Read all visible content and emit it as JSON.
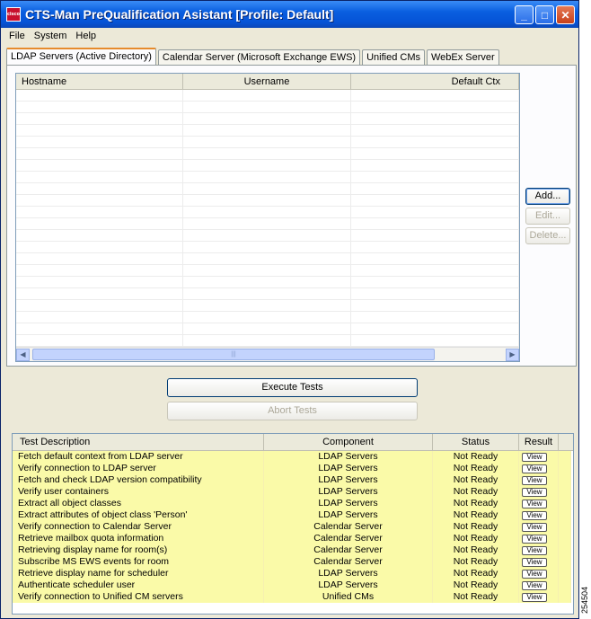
{
  "window": {
    "title": "CTS-Man PreQualification Asistant [Profile: Default]",
    "icon_text": "cisco"
  },
  "menu": [
    "File",
    "System",
    "Help"
  ],
  "tabs": [
    {
      "label": "LDAP Servers (Active Directory)",
      "active": true
    },
    {
      "label": "Calendar Server (Microsoft Exchange EWS)",
      "active": false
    },
    {
      "label": "Unified CMs",
      "active": false
    },
    {
      "label": "WebEx Server",
      "active": false
    }
  ],
  "server_table": {
    "columns": [
      "Hostname",
      "Username",
      "Default Ctx"
    ],
    "rows": []
  },
  "side_buttons": {
    "add": "Add...",
    "edit": "Edit...",
    "delete": "Delete..."
  },
  "actions": {
    "execute": "Execute Tests",
    "abort": "Abort Tests"
  },
  "results_table": {
    "columns": [
      "Test Description",
      "Component",
      "Status",
      "Result"
    ],
    "rows": [
      {
        "desc": "Fetch default context from LDAP server",
        "component": "LDAP Servers",
        "status": "Not Ready",
        "result": "View"
      },
      {
        "desc": "Verify connection to LDAP server",
        "component": "LDAP Servers",
        "status": "Not Ready",
        "result": "View"
      },
      {
        "desc": "Fetch and check LDAP version compatibility",
        "component": "LDAP Servers",
        "status": "Not Ready",
        "result": "View"
      },
      {
        "desc": "Verify user containers",
        "component": "LDAP Servers",
        "status": "Not Ready",
        "result": "View"
      },
      {
        "desc": "Extract all object classes",
        "component": "LDAP Servers",
        "status": "Not Ready",
        "result": "View"
      },
      {
        "desc": "Extract attributes of object class 'Person'",
        "component": "LDAP Servers",
        "status": "Not Ready",
        "result": "View"
      },
      {
        "desc": "Verify connection to Calendar Server",
        "component": "Calendar Server",
        "status": "Not Ready",
        "result": "View"
      },
      {
        "desc": "Retrieve mailbox quota information",
        "component": "Calendar Server",
        "status": "Not Ready",
        "result": "View"
      },
      {
        "desc": "Retrieving display name for room(s)",
        "component": "Calendar Server",
        "status": "Not Ready",
        "result": "View"
      },
      {
        "desc": "Subscribe MS EWS events for room",
        "component": "Calendar Server",
        "status": "Not Ready",
        "result": "View"
      },
      {
        "desc": "Retrieve display name for scheduler",
        "component": "LDAP Servers",
        "status": "Not Ready",
        "result": "View"
      },
      {
        "desc": "Authenticate scheduler user",
        "component": "LDAP Servers",
        "status": "Not Ready",
        "result": "View"
      },
      {
        "desc": "Verify connection to Unified CM servers",
        "component": "Unified CMs",
        "status": "Not Ready",
        "result": "View"
      }
    ]
  },
  "figure_number": "254504",
  "colors": {
    "row_highlight": "#fafaa8",
    "titlebar": "#0553d6",
    "tab_accent": "#e68b2c"
  }
}
